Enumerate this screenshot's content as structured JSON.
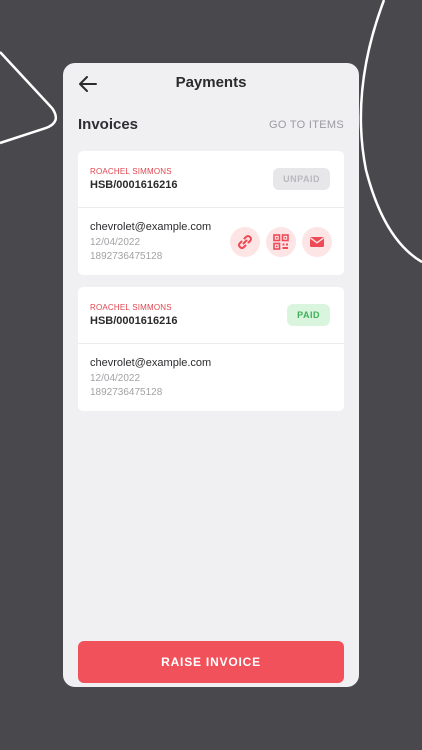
{
  "header": {
    "title": "Payments"
  },
  "section": {
    "title": "Invoices",
    "link": "GO TO ITEMS"
  },
  "invoices": [
    {
      "client": "ROACHEL SIMMONS",
      "number": "HSB/0001616216",
      "status": "UNPAID",
      "email": "chevrolet@example.com",
      "date": "12/04/2022",
      "phone": "1892736475128",
      "actions": [
        "link-icon",
        "qr-code-icon",
        "mail-icon"
      ]
    },
    {
      "client": "ROACHEL SIMMONS",
      "number": "HSB/0001616216",
      "status": "PAID",
      "email": "chevrolet@example.com",
      "date": "12/04/2022",
      "phone": "1892736475128"
    }
  ],
  "footer": {
    "button": "RAISE INVOICE"
  },
  "colors": {
    "background": "#49484c",
    "accent": "#f1515a",
    "client_label": "#e0454e",
    "paid": "#3fb05a",
    "unpaid": "#b9b9bd"
  }
}
